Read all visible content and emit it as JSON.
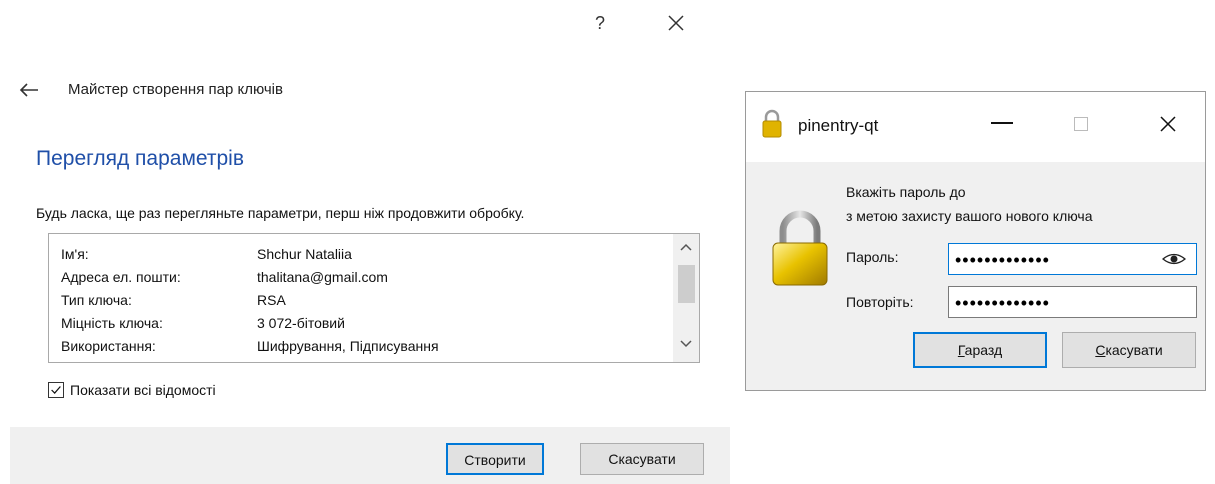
{
  "wizard": {
    "help_label": "?",
    "title": "Майстер створення пар ключів",
    "heading": "Перегляд параметрів",
    "description": "Будь ласка, ще раз перегляньте параметри, перш ніж продовжити обробку.",
    "params": [
      {
        "label": "Ім'я:",
        "value": "Shchur Nataliia"
      },
      {
        "label": "Адреса ел. пошти:",
        "value": "thalitana@gmail.com"
      },
      {
        "label": "Тип ключа:",
        "value": "RSA"
      },
      {
        "label": "Міцність ключа:",
        "value": "3 072-бітовий"
      },
      {
        "label": "Використання:",
        "value": "Шифрування, Підписування"
      }
    ],
    "show_all_label": "Показати всі відомості",
    "show_all_checked": true,
    "create_label": "Створити",
    "cancel_label": "Скасувати"
  },
  "pinentry": {
    "title": "pinentry-qt",
    "desc_line1": "Вкажіть пароль до",
    "desc_line2": "з метою захисту вашого нового ключа",
    "password_label": "Пароль:",
    "password_mask": "•••••••••••••",
    "repeat_label": "Повторіть:",
    "repeat_mask": "•••••••••••••",
    "ok_label_first": "Г",
    "ok_label_rest": "аразд",
    "cancel_label_first": "С",
    "cancel_label_rest": "касувати"
  },
  "colors": {
    "heading": "#1f4fa8",
    "focus_blue": "#0078d7",
    "lock_gold": "#e0b300"
  },
  "icons": [
    "back-arrow-icon",
    "close-icon",
    "chevron-up-icon",
    "chevron-down-icon",
    "check-icon",
    "lock-icon",
    "eye-icon",
    "minimize-icon",
    "maximize-icon"
  ]
}
